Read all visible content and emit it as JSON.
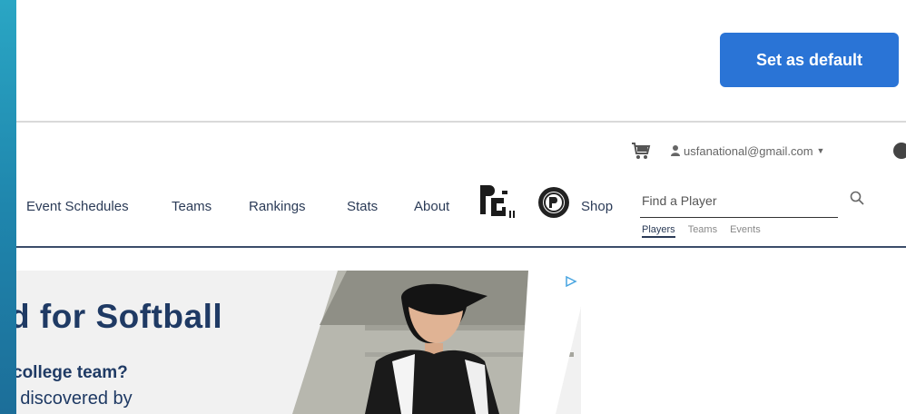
{
  "banner": {
    "set_default_label": "Set as default"
  },
  "utility": {
    "user_email": "usfanational@gmail.com",
    "cart_icon": "cart-icon",
    "user_icon": "user-icon"
  },
  "nav": {
    "items": [
      "Event Schedules",
      "Teams",
      "Rankings",
      "Stats",
      "About"
    ],
    "shop_label": "Shop"
  },
  "search": {
    "placeholder": "Find a Player",
    "tabs": [
      "Players",
      "Teams",
      "Events"
    ],
    "active_tab": "Players"
  },
  "ad": {
    "title": "d for Softball",
    "sub1": "college team?",
    "sub2": "r discovered by"
  },
  "colors": {
    "button": "#2a74d6",
    "nav_text": "#2b3b57",
    "ad_text": "#1f3a64"
  }
}
